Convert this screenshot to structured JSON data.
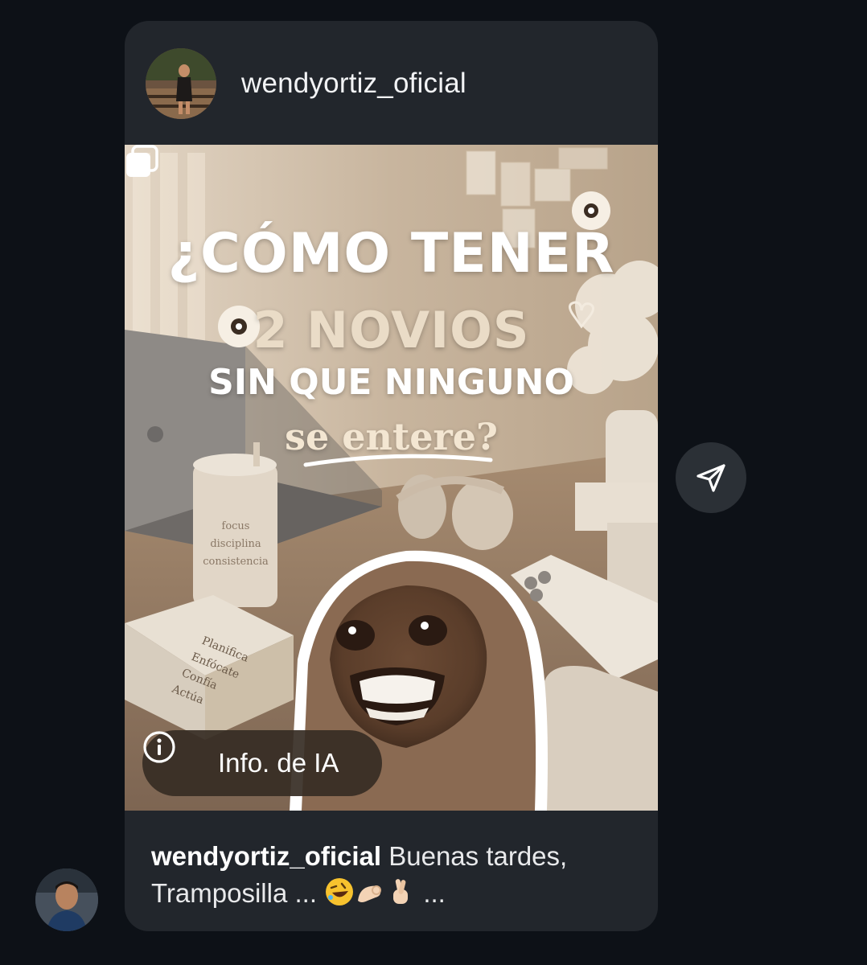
{
  "post": {
    "author": "wendyortiz_oficial",
    "headline": {
      "line1": "¿CÓMO TENER",
      "line2": "2 NOVIOS",
      "line3": "SIN QUE NINGUNO",
      "line4": "se entere?"
    },
    "cup_text": [
      "focus",
      "disciplina",
      "consistencia"
    ],
    "notebook_text": [
      "Planifica",
      "Enfócate",
      "Confía",
      "Actúa"
    ],
    "ai_info_label": "Info. de IA",
    "caption": {
      "author": "wendyortiz_oficial",
      "text": " Buenas tardes, Tramposilla ... ",
      "trailing": " ..."
    }
  },
  "icons": {
    "carousel": "carousel-icon",
    "info": "info-icon",
    "share": "send-icon",
    "emojis": [
      "rolling-laughing-emoji",
      "ok-hand-emoji",
      "crossed-fingers-emoji"
    ]
  },
  "colors": {
    "background": "#0d1117",
    "card": "#22262c",
    "share_button": "#2b3036"
  }
}
